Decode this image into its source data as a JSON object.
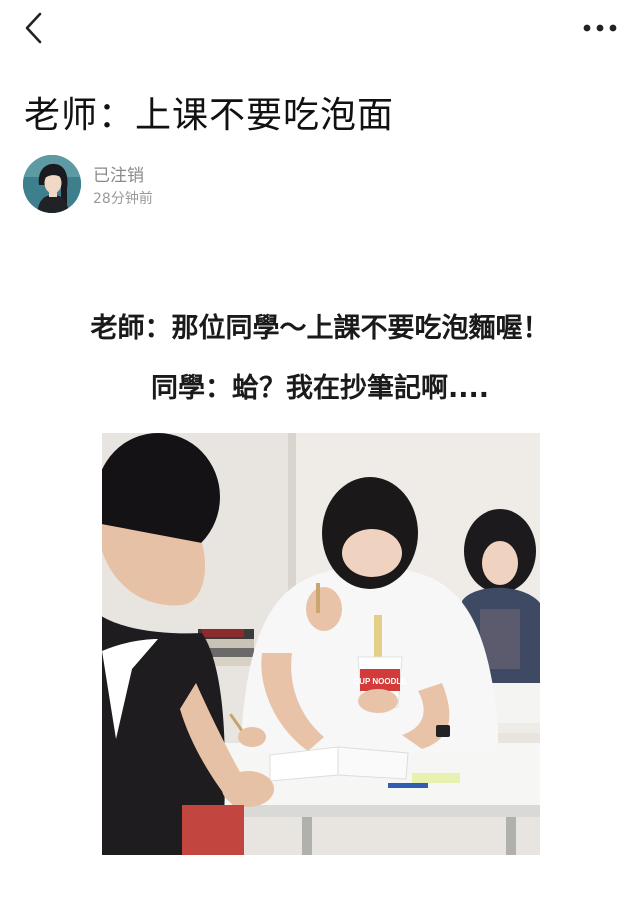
{
  "title": "老师：上课不要吃泡面",
  "author": {
    "name": "已注销",
    "time": "28分钟前"
  },
  "caption": {
    "line1": "老師：那位同學～上課不要吃泡麵喔！",
    "line2": "同學：蛤？我在抄筆記啊...."
  },
  "photo": {
    "cup_text": "CUP NOODLE"
  },
  "icons": {
    "back": "back-chevron-icon",
    "more": "more-dots-icon"
  },
  "colors": {
    "title": "#111111",
    "meta": "#8a8a8a",
    "cup_red": "#d33a3a"
  }
}
